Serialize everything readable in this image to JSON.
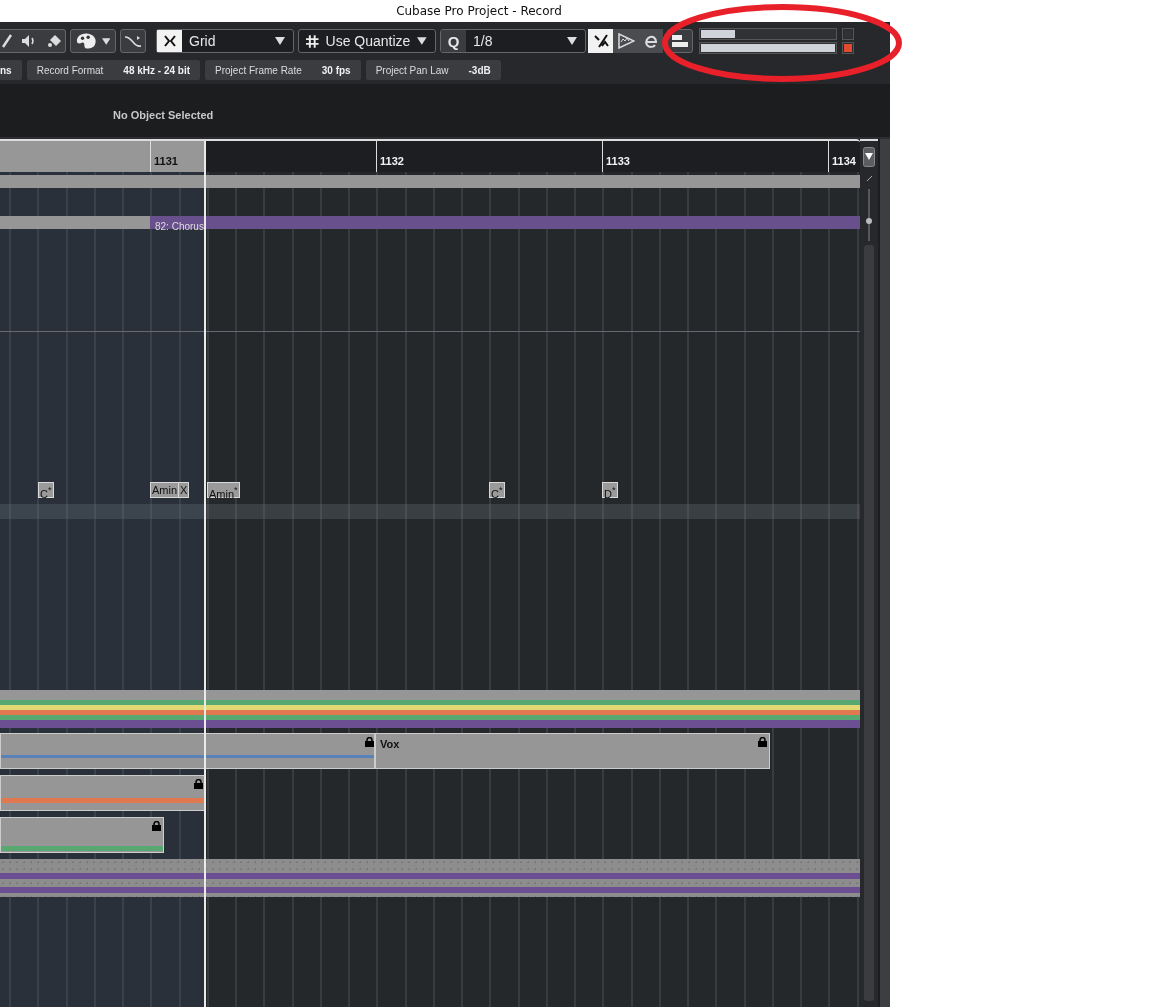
{
  "window": {
    "title": "Cubase Pro Project - Record"
  },
  "toolbar": {
    "snap_mode": "Grid",
    "grid_type": "Use Quantize",
    "quantize_label": "Q",
    "quantize": "1/8",
    "toggles": [
      {
        "kind": "snap",
        "on": true
      },
      {
        "kind": "iq",
        "on": false
      },
      {
        "kind": "edit",
        "on": false
      }
    ],
    "meters": [
      {
        "level": 0.25
      },
      {
        "level": 1.0
      }
    ],
    "indicators": [
      {
        "on": false
      },
      {
        "on": true
      }
    ]
  },
  "status_bar": [
    {
      "value": "ns"
    },
    {
      "label": "Record Format",
      "value": "48 kHz - 24 bit"
    },
    {
      "label": "Project Frame Rate",
      "value": "30 fps"
    },
    {
      "label": "Project Pan Law",
      "value": "-3dB"
    }
  ],
  "info_line": "No Object Selected",
  "ruler": {
    "bars": [
      "1131",
      "1132",
      "1133",
      "1134"
    ]
  },
  "marker": "82: Chorus",
  "chords": [
    {
      "label": "C$^{*}$"
    },
    {
      "label": "Amin"
    },
    {
      "label": "X"
    },
    {
      "label": "Amin$^{*}$"
    },
    {
      "label": "C$^{*}$"
    },
    {
      "label": "D$^{*}$"
    }
  ],
  "events": [
    {
      "name": "Vox",
      "locked": true
    }
  ],
  "annotation": {
    "kind": "ellipse",
    "color": "#e8202a"
  }
}
